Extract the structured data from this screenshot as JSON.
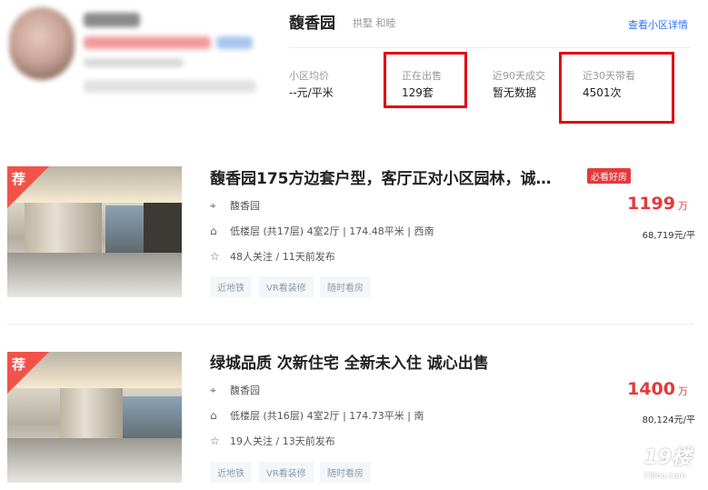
{
  "community": {
    "name": "馥香园",
    "tags": "拱墅 和睦",
    "detail_link": "查看小区详情",
    "stats": [
      {
        "label": "小区均价",
        "value": "--元/平米"
      },
      {
        "label": "正在出售",
        "value": "129套"
      },
      {
        "label": "近90天成交",
        "value": "暂无数据"
      },
      {
        "label": "近30天带看",
        "value": "4501次"
      }
    ]
  },
  "listings": [
    {
      "badge": "荐",
      "title": "馥香园175方边套户型，客厅正对小区园林，诚…",
      "must_see": "必看好房",
      "community": "馥香园",
      "info": "低楼层 (共17层) 4室2厅 | 174.48平米 | 西南",
      "follow": "48人关注 / 11天前发布",
      "price": "1199",
      "price_unit": "万",
      "unit_price": "68,719元/平",
      "tags": [
        "近地铁",
        "VR看装修",
        "随时看房"
      ]
    },
    {
      "badge": "荐",
      "title": "绿城品质 次新住宅 全新未入住 诚心出售",
      "community": "馥香园",
      "info": "低楼层 (共16层) 4室2厅 | 174.73平米 | 南",
      "follow": "19人关注 / 13天前发布",
      "price": "1400",
      "price_unit": "万",
      "unit_price": "80,124元/平",
      "tags": [
        "近地铁",
        "VR看装修",
        "随时看房"
      ]
    }
  ],
  "watermark": {
    "logo": "19楼",
    "url": "19lou.com"
  },
  "colors": {
    "accent_red": "#e4393c",
    "link_blue": "#3072f6",
    "highlight_box": "#e30613"
  }
}
